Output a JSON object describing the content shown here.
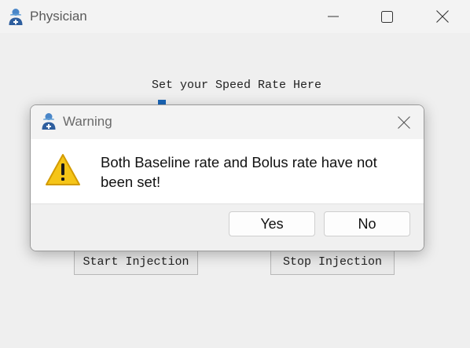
{
  "window": {
    "title": "Physician",
    "app_icon": "doctor-icon"
  },
  "main": {
    "speed_label": "Set your Speed Rate Here",
    "start_button": "Start Injection",
    "stop_button": "Stop Injection"
  },
  "dialog": {
    "title": "Warning",
    "icon": "doctor-icon",
    "status_icon": "warning-icon",
    "message": "Both Baseline rate and Bolus rate have not been set!",
    "yes_label": "Yes",
    "no_label": "No"
  },
  "colors": {
    "accent": "#1a66b8",
    "warning": "#f5c518"
  }
}
